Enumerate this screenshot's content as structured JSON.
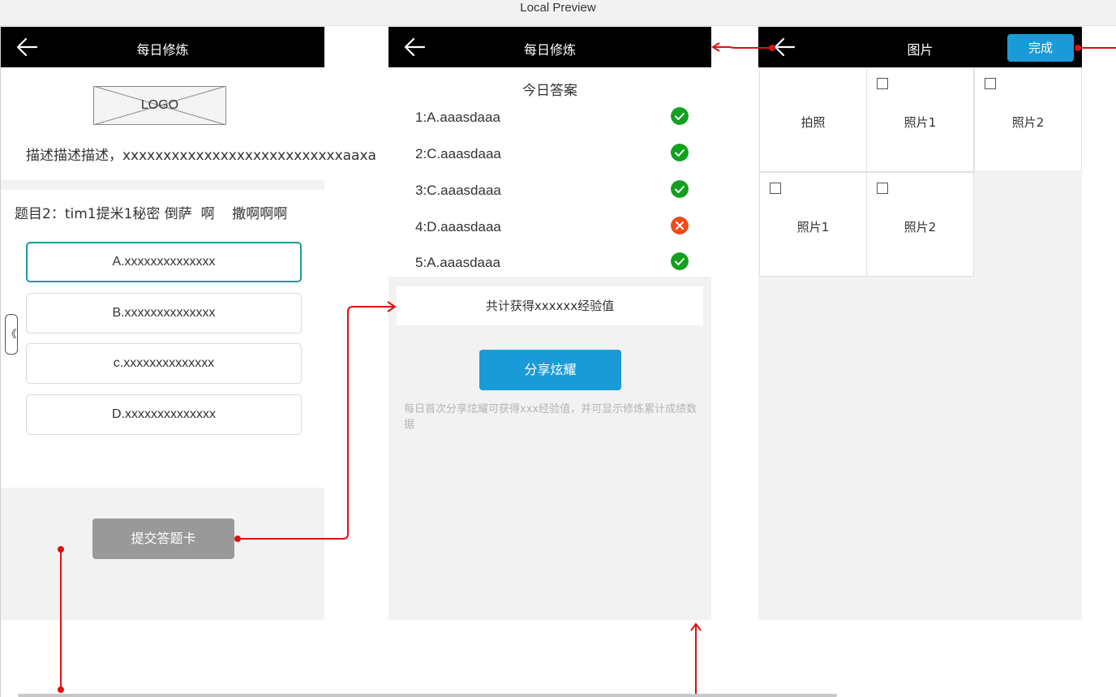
{
  "window": {
    "title": "Local Preview"
  },
  "screen1": {
    "header_title": "每日修炼",
    "logo_text": "LOGO",
    "description": "描述描述描述，xxxxxxxxxxxxxxxxxxxxxxxxxxxaaxa",
    "question": "题目2：tim1提米1秘密 倒萨  啊    撒啊啊啊",
    "options": [
      {
        "label": "A.xxxxxxxxxxxxxx",
        "selected": true
      },
      {
        "label": "B.xxxxxxxxxxxxxx",
        "selected": false
      },
      {
        "label": "c.xxxxxxxxxxxxxx",
        "selected": false
      },
      {
        "label": "D.xxxxxxxxxxxxxx",
        "selected": false
      }
    ],
    "submit_label": "提交答题卡",
    "collapse_handle": "《"
  },
  "screen2": {
    "header_title": "每日修炼",
    "answers_title": "今日答案",
    "answers": [
      {
        "text": "1:A.aaasdaaa",
        "status": "correct"
      },
      {
        "text": "2:C.aaasdaaa",
        "status": "correct"
      },
      {
        "text": "3:C.aaasdaaa",
        "status": "correct"
      },
      {
        "text": "4:D.aaasdaaa",
        "status": "wrong"
      },
      {
        "text": "5:A.aaasdaaa",
        "status": "correct"
      }
    ],
    "total_text": "共计获得xxxxxx经验值",
    "share_label": "分享炫耀",
    "note": "每日首次分享炫耀可获得xxx经验值，并可显示修炼累计成绩数据"
  },
  "screen3": {
    "header_title": "图片",
    "done_label": "完成",
    "cells": [
      {
        "label": "拍照",
        "checkbox": false
      },
      {
        "label": "照片1",
        "checkbox": true
      },
      {
        "label": "照片2",
        "checkbox": true
      },
      {
        "label": "照片1",
        "checkbox": true
      },
      {
        "label": "照片2",
        "checkbox": true
      }
    ]
  },
  "colors": {
    "header_bg": "#000000",
    "accent_blue": "#1a9bd7",
    "selected_border": "#1f9a9a",
    "correct_green": "#12a01e",
    "wrong_orange": "#f04a1a",
    "connector_red": "#e01010",
    "submit_gray": "#999999",
    "panel_gray": "#f2f2f2"
  }
}
